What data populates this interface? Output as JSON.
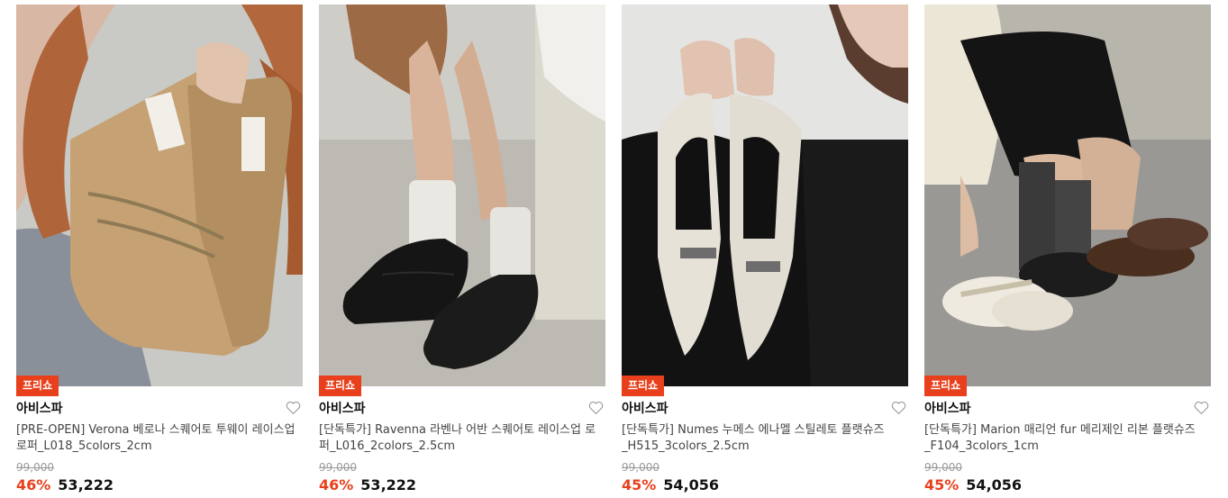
{
  "products": [
    {
      "badge": "프리쇼",
      "brand": "아비스파",
      "title": "[PRE-OPEN] Verona 베로나 스퀘어토 투웨이 레이스업 로퍼_L018_5colors_2cm",
      "original_price": "99,000",
      "discount": "46%",
      "price": "53,222",
      "image": "model holding camel suede lace-up loafers"
    },
    {
      "badge": "프리쇼",
      "brand": "아비스파",
      "title": "[단독특가] Ravenna 라벤나 어반 스퀘어토 레이스업 로퍼_L016_2colors_2.5cm",
      "original_price": "99,000",
      "discount": "46%",
      "price": "53,222",
      "image": "black leather square-toe lace-up loafers with white socks"
    },
    {
      "badge": "프리쇼",
      "brand": "아비스파",
      "title": "[단독특가] Numes 누메스 에나멜 스틸레토 플랫슈즈_H515_3colors_2.5cm",
      "original_price": "99,000",
      "discount": "45%",
      "price": "54,056",
      "image": "model holding ivory enamel pointed slingback flats"
    },
    {
      "badge": "프리쇼",
      "brand": "아비스파",
      "title": "[단독특가] Marion 매리언 fur 메리제인 리본 플랫슈즈_F104_3colors_1cm",
      "original_price": "99,000",
      "discount": "45%",
      "price": "54,056",
      "image": "fur mary jane ribbon flats in ivory, black and brown"
    }
  ],
  "colors": {
    "badge": "#e8401c",
    "discount": "#e8401c",
    "strike": "#999999"
  },
  "icons": {
    "wishlist": "heart-outline-icon"
  }
}
